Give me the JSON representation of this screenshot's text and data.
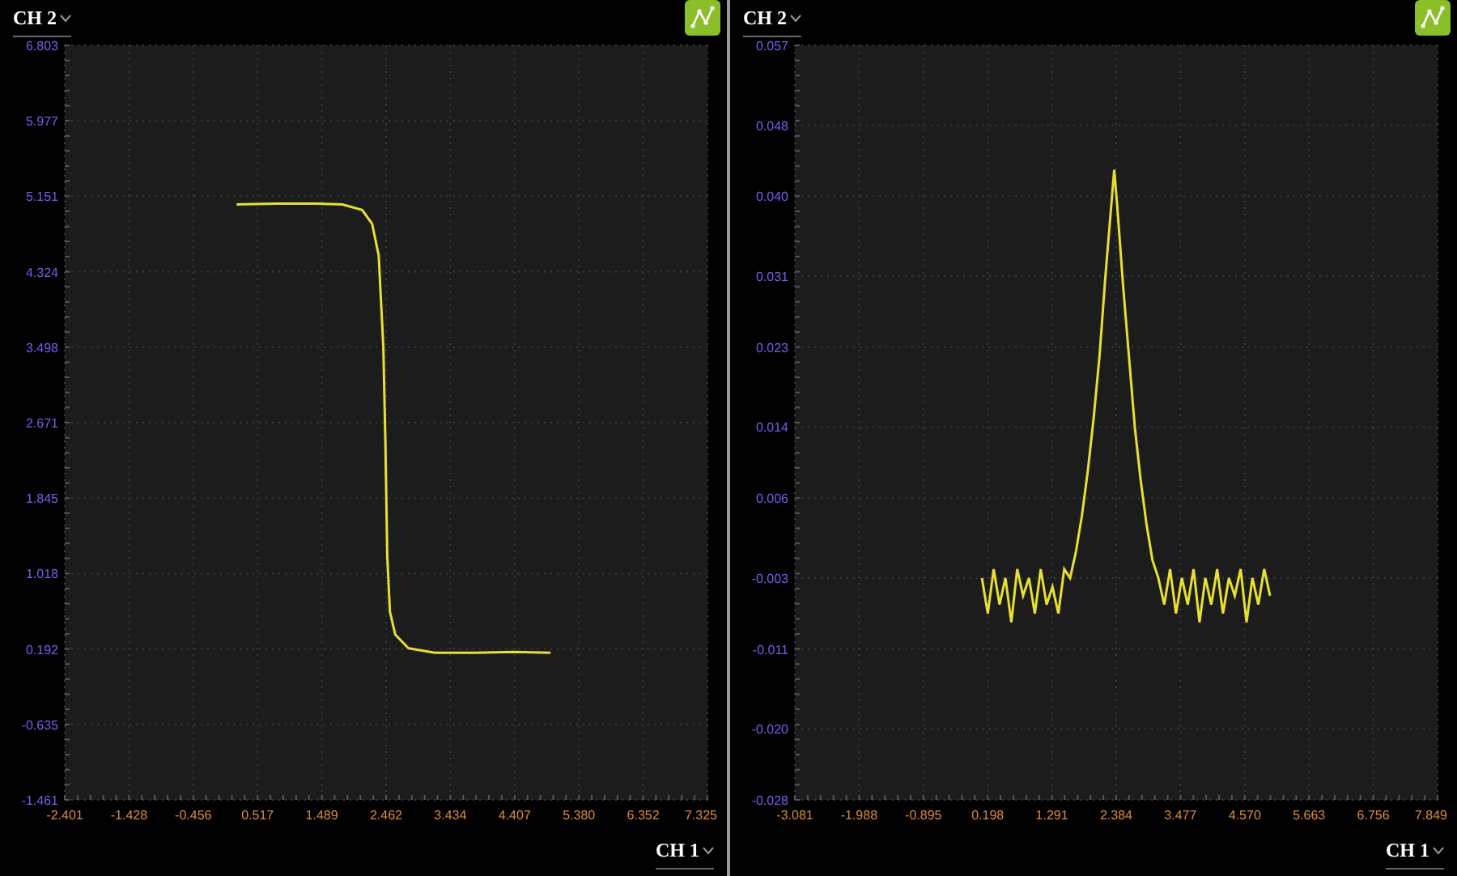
{
  "panels": [
    {
      "y_channel": {
        "label": "CH 2"
      },
      "x_channel": {
        "label": "CH 1"
      },
      "chart_data": {
        "type": "line",
        "grid": true,
        "xlim": [
          -2.401,
          7.325
        ],
        "ylim": [
          -1.461,
          6.803
        ],
        "xticks": [
          {
            "value": -2.401,
            "label": "-2.401"
          },
          {
            "value": -1.428,
            "label": "-1.428"
          },
          {
            "value": -0.456,
            "label": "-0.456"
          },
          {
            "value": 0.517,
            "label": "0.517"
          },
          {
            "value": 1.489,
            "label": "1.489"
          },
          {
            "value": 2.462,
            "label": "2.462"
          },
          {
            "value": 3.434,
            "label": "3.434"
          },
          {
            "value": 4.407,
            "label": "4.407"
          },
          {
            "value": 5.38,
            "label": "5.380"
          },
          {
            "value": 6.352,
            "label": "6.352"
          },
          {
            "value": 7.325,
            "label": "7.325"
          }
        ],
        "yticks": [
          {
            "value": 6.803,
            "label": "6.803"
          },
          {
            "value": 5.977,
            "label": "5.977"
          },
          {
            "value": 5.151,
            "label": "5.151"
          },
          {
            "value": 4.324,
            "label": "4.324"
          },
          {
            "value": 3.498,
            "label": "3.498"
          },
          {
            "value": 2.671,
            "label": "2.671"
          },
          {
            "value": 1.845,
            "label": "1.845"
          },
          {
            "value": 1.018,
            "label": "1.018"
          },
          {
            "value": 0.192,
            "label": "0.192"
          },
          {
            "value": -0.635,
            "label": "-0.635"
          },
          {
            "value": -1.461,
            "label": "-1.461"
          }
        ],
        "x": [
          0.2,
          0.8,
          1.4,
          1.8,
          2.1,
          2.25,
          2.35,
          2.42,
          2.45,
          2.48,
          2.52,
          2.6,
          2.8,
          3.2,
          3.8,
          4.4,
          4.95
        ],
        "series": [
          {
            "color": "#e8e030",
            "values": [
              5.06,
              5.07,
              5.07,
              5.06,
              5.0,
              4.85,
              4.5,
              3.5,
              2.5,
              1.2,
              0.6,
              0.35,
              0.2,
              0.15,
              0.15,
              0.16,
              0.15
            ]
          }
        ]
      }
    },
    {
      "y_channel": {
        "label": "CH 2"
      },
      "x_channel": {
        "label": "CH 1"
      },
      "chart_data": {
        "type": "line",
        "grid": true,
        "xlim": [
          -3.081,
          7.849
        ],
        "ylim": [
          -0.028,
          0.057
        ],
        "xticks": [
          {
            "value": -3.081,
            "label": "-3.081"
          },
          {
            "value": -1.988,
            "label": "-1.988"
          },
          {
            "value": -0.895,
            "label": "-0.895"
          },
          {
            "value": 0.198,
            "label": "0.198"
          },
          {
            "value": 1.291,
            "label": "1.291"
          },
          {
            "value": 2.384,
            "label": "2.384"
          },
          {
            "value": 3.477,
            "label": "3.477"
          },
          {
            "value": 4.57,
            "label": "4.570"
          },
          {
            "value": 5.663,
            "label": "5.663"
          },
          {
            "value": 6.756,
            "label": "6.756"
          },
          {
            "value": 7.849,
            "label": "7.849"
          }
        ],
        "yticks": [
          {
            "value": 0.057,
            "label": "0.057"
          },
          {
            "value": 0.048,
            "label": "0.048"
          },
          {
            "value": 0.04,
            "label": "0.040"
          },
          {
            "value": 0.031,
            "label": "0.031"
          },
          {
            "value": 0.023,
            "label": "0.023"
          },
          {
            "value": 0.014,
            "label": "0.014"
          },
          {
            "value": 0.006,
            "label": "0.006"
          },
          {
            "value": -0.003,
            "label": "-0.003"
          },
          {
            "value": -0.011,
            "label": "-0.011"
          },
          {
            "value": -0.02,
            "label": "-0.020"
          },
          {
            "value": -0.028,
            "label": "-0.028"
          }
        ],
        "x": [
          0.1,
          0.2,
          0.3,
          0.4,
          0.5,
          0.6,
          0.7,
          0.8,
          0.9,
          1.0,
          1.1,
          1.2,
          1.3,
          1.4,
          1.5,
          1.6,
          1.7,
          1.8,
          1.9,
          2.0,
          2.1,
          2.2,
          2.3,
          2.35,
          2.4,
          2.5,
          2.6,
          2.7,
          2.8,
          2.9,
          3.0,
          3.1,
          3.2,
          3.3,
          3.4,
          3.5,
          3.6,
          3.7,
          3.8,
          3.9,
          4.0,
          4.1,
          4.2,
          4.3,
          4.4,
          4.5,
          4.6,
          4.7,
          4.8,
          4.9,
          5.0
        ],
        "series": [
          {
            "color": "#e8e030",
            "values": [
              -0.003,
              -0.007,
              -0.002,
              -0.006,
              -0.003,
              -0.008,
              -0.002,
              -0.005,
              -0.003,
              -0.007,
              -0.002,
              -0.006,
              -0.004,
              -0.007,
              -0.002,
              -0.003,
              0.0,
              0.004,
              0.009,
              0.015,
              0.022,
              0.031,
              0.039,
              0.043,
              0.039,
              0.03,
              0.022,
              0.014,
              0.008,
              0.003,
              -0.001,
              -0.003,
              -0.006,
              -0.002,
              -0.007,
              -0.003,
              -0.006,
              -0.002,
              -0.008,
              -0.003,
              -0.006,
              -0.002,
              -0.007,
              -0.003,
              -0.005,
              -0.002,
              -0.008,
              -0.003,
              -0.006,
              -0.002,
              -0.005
            ]
          }
        ]
      }
    }
  ]
}
